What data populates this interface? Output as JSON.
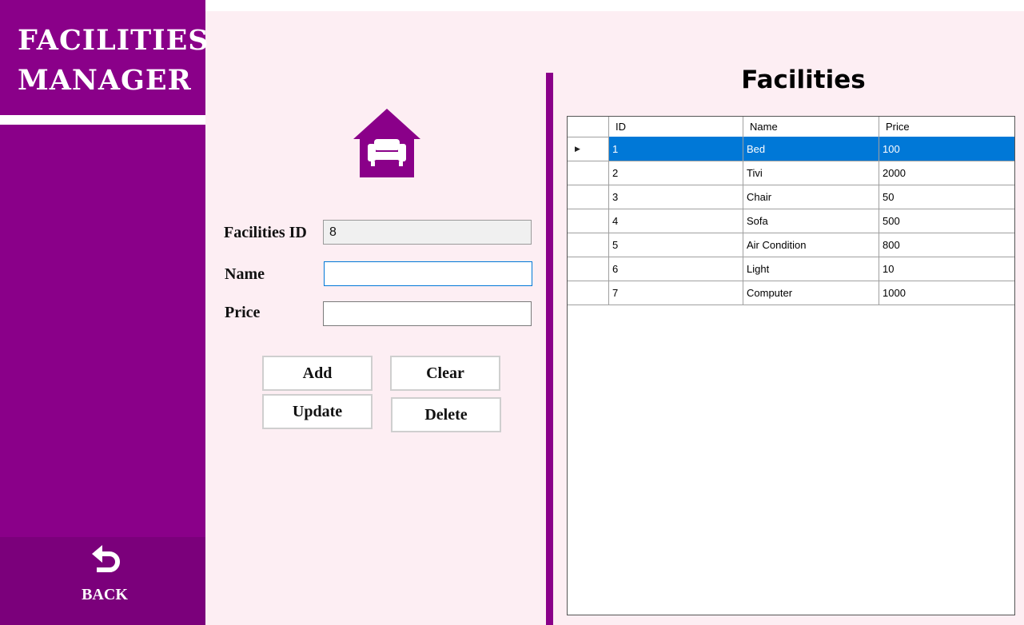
{
  "sidebar": {
    "title_line1": "FACILITIES",
    "title_line2": "MANAGER",
    "back_label": "BACK",
    "back_icon": "undo-arrow-icon",
    "color": "#8a0089"
  },
  "form": {
    "icon": "sofa-home-icon",
    "id_label": "Facilities ID",
    "id_value": "8",
    "name_label": "Name",
    "name_value": "",
    "price_label": "Price",
    "price_value": "",
    "add_label": "Add",
    "clear_label": "Clear",
    "update_label": "Update",
    "delete_label": "Delete"
  },
  "grid": {
    "title": "Facilities",
    "columns": [
      "ID",
      "Name",
      "Price"
    ],
    "selected_row_indicator": "▶",
    "selection_color": "#0078d7",
    "rows": [
      {
        "id": "1",
        "name": "Bed",
        "price": "100",
        "selected": true
      },
      {
        "id": "2",
        "name": "Tivi",
        "price": "2000"
      },
      {
        "id": "3",
        "name": "Chair",
        "price": "50"
      },
      {
        "id": "4",
        "name": "Sofa",
        "price": "500"
      },
      {
        "id": "5",
        "name": "Air Condition",
        "price": "800"
      },
      {
        "id": "6",
        "name": "Light",
        "price": "10"
      },
      {
        "id": "7",
        "name": "Computer",
        "price": "1000"
      }
    ]
  }
}
